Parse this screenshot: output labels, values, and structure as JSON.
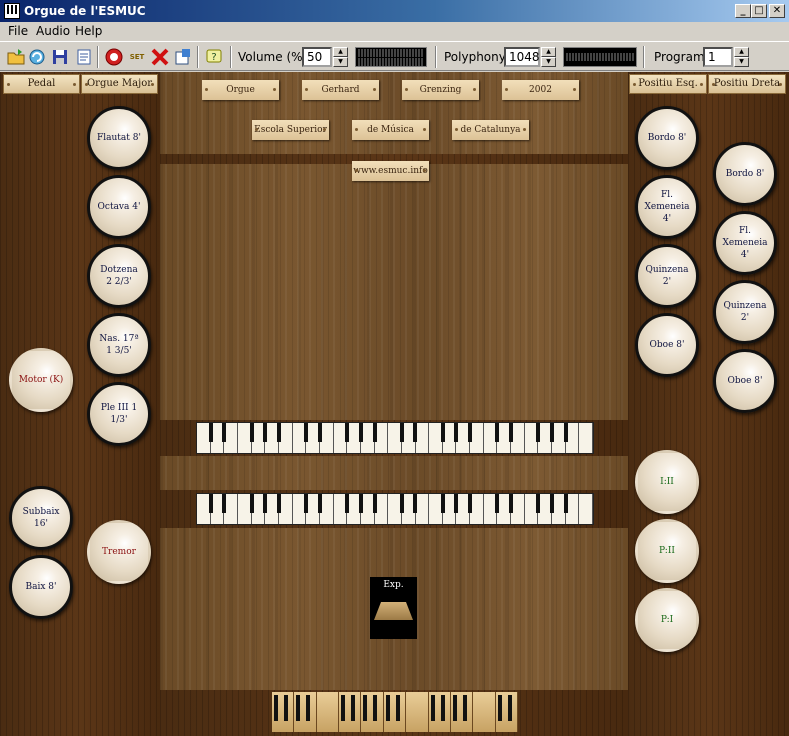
{
  "window": {
    "title": "Orgue de l'ESMUC",
    "minimize": "_",
    "maximize": "□",
    "close": "✕"
  },
  "menu": [
    "File",
    "Audio",
    "Help"
  ],
  "toolbar": {
    "icons": [
      "open-icon",
      "reload-icon",
      "save-icon",
      "properties-icon",
      "record-icon",
      "set-icon",
      "cancel-icon",
      "settings-icon",
      "help-icon"
    ],
    "set_label": "SET",
    "volume_label": "Volume (%):",
    "volume_value": "50",
    "polyphony_label": "Polyphony:",
    "polyphony_value": "1048",
    "program_label": "Program:",
    "program_value": "1"
  },
  "headers": {
    "pedal": "Pedal",
    "orgue_major": "Orgue Major",
    "positiu_esq": "Positiu Esq.",
    "positiu_dreta": "Positiu Dreta"
  },
  "plates": {
    "orgue": "Orgue",
    "gerhard": "Gerhard",
    "grenzing": "Grenzing",
    "year": "2002",
    "escola": "Escola Superior",
    "musica": "de Música",
    "catalunya": "de Catalunya",
    "web": "www.esmuc.info"
  },
  "stops": {
    "orgue_major": [
      "Flautat 8'",
      "Octava 4'",
      "Dotzena 2 2/3'",
      "Nas. 17ª 1 3/5'",
      "Ple III 1 1/3'"
    ],
    "tremolo": "Tremor",
    "motor": "Motor (K)",
    "pedal": [
      "Subbaix 16'",
      "Baix 8'"
    ],
    "positiu_esq": [
      "Bordo 8'",
      "Fl. Xemeneia 4'",
      "Quinzena 2'",
      "Oboe 8'"
    ],
    "positiu_dreta": [
      "Bordo 8'",
      "Fl. Xemeneia 4'",
      "Quinzena 2'",
      "Oboe 8'"
    ],
    "couplers": [
      "I:II",
      "P:II",
      "P:I"
    ]
  },
  "expression": {
    "label": "Exp."
  }
}
